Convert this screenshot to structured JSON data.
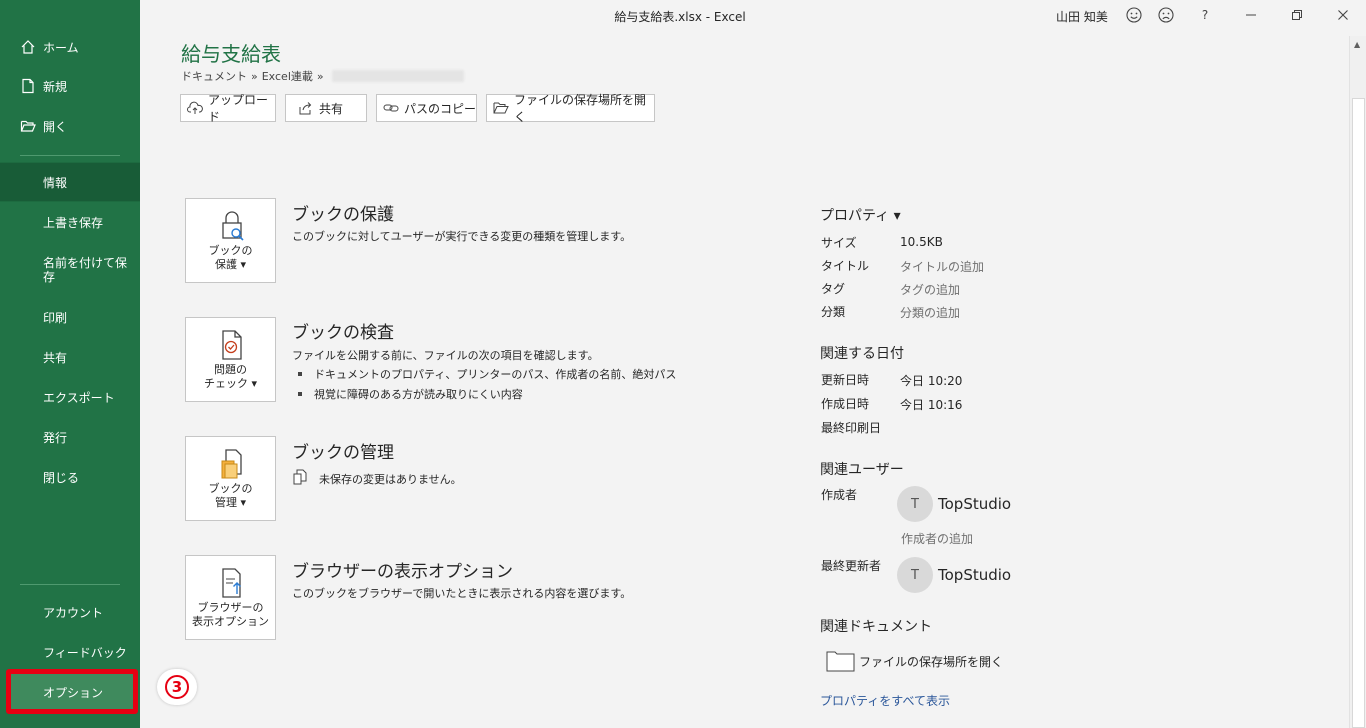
{
  "window": {
    "title": "給与支給表.xlsx  -  Excel",
    "user": "山田 知美",
    "help": "?"
  },
  "sidebar": {
    "items": [
      {
        "label": "ホーム"
      },
      {
        "label": "新規"
      },
      {
        "label": "開く"
      },
      {
        "label": "情報"
      },
      {
        "label": "上書き保存"
      },
      {
        "label": "名前を付けて保存"
      },
      {
        "label": "印刷"
      },
      {
        "label": "共有"
      },
      {
        "label": "エクスポート"
      },
      {
        "label": "発行"
      },
      {
        "label": "閉じる"
      },
      {
        "label": "アカウント"
      },
      {
        "label": "フィードバック"
      },
      {
        "label": "オプション"
      }
    ],
    "active": "情報",
    "annotation_number": "3"
  },
  "header": {
    "title": "給与支給表",
    "breadcrumb": [
      "ドキュメント",
      "»",
      "Excel連載",
      "»"
    ],
    "buttons": [
      {
        "label": "アップロード",
        "icon": "upload-cloud-icon"
      },
      {
        "label": "共有",
        "icon": "share-icon"
      },
      {
        "label": "パスのコピー",
        "icon": "link-icon"
      },
      {
        "label": "ファイルの保存場所を開く",
        "icon": "folder-open-icon"
      }
    ]
  },
  "sections": [
    {
      "button_line1": "ブックの",
      "button_line2": "保護 ▾",
      "title": "ブックの保護",
      "desc": "このブックに対してユーザーが実行できる変更の種類を管理します。"
    },
    {
      "button_line1": "問題の",
      "button_line2": "チェック ▾",
      "title": "ブックの検査",
      "desc": "ファイルを公開する前に、ファイルの次の項目を確認します。",
      "bullets": [
        "ドキュメントのプロパティ、プリンターのパス、作成者の名前、絶対パス",
        "視覚に障碍のある方が読み取りにくい内容"
      ]
    },
    {
      "button_line1": "ブックの",
      "button_line2": "管理 ▾",
      "title": "ブックの管理",
      "desc": "未保存の変更はありません。"
    },
    {
      "button_line1": "ブラウザーの",
      "button_line2": "表示オプション",
      "title": "ブラウザーの表示オプション",
      "desc": "このブックをブラウザーで開いたときに表示される内容を選びます。"
    }
  ],
  "properties": {
    "heading": "プロパティ ▾",
    "rows": [
      {
        "label": "サイズ",
        "value": "10.5KB"
      },
      {
        "label": "タイトル",
        "value": "タイトルの追加"
      },
      {
        "label": "タグ",
        "value": "タグの追加"
      },
      {
        "label": "分類",
        "value": "分類の追加"
      }
    ]
  },
  "dates": {
    "heading": "関連する日付",
    "rows": [
      {
        "label": "更新日時",
        "value": "今日 10:20"
      },
      {
        "label": "作成日時",
        "value": "今日 10:16"
      },
      {
        "label": "最終印刷日",
        "value": ""
      }
    ]
  },
  "people": {
    "heading": "関連ユーザー",
    "author_label": "作成者",
    "author_initial": "T",
    "author_name": "TopStudio",
    "add_author": "作成者の追加",
    "last_modified_label": "最終更新者",
    "last_modified_initial": "T",
    "last_modified_name": "TopStudio"
  },
  "related_docs": {
    "heading": "関連ドキュメント",
    "open_location": "ファイルの保存場所を開く",
    "show_all": "プロパティをすべて表示"
  }
}
